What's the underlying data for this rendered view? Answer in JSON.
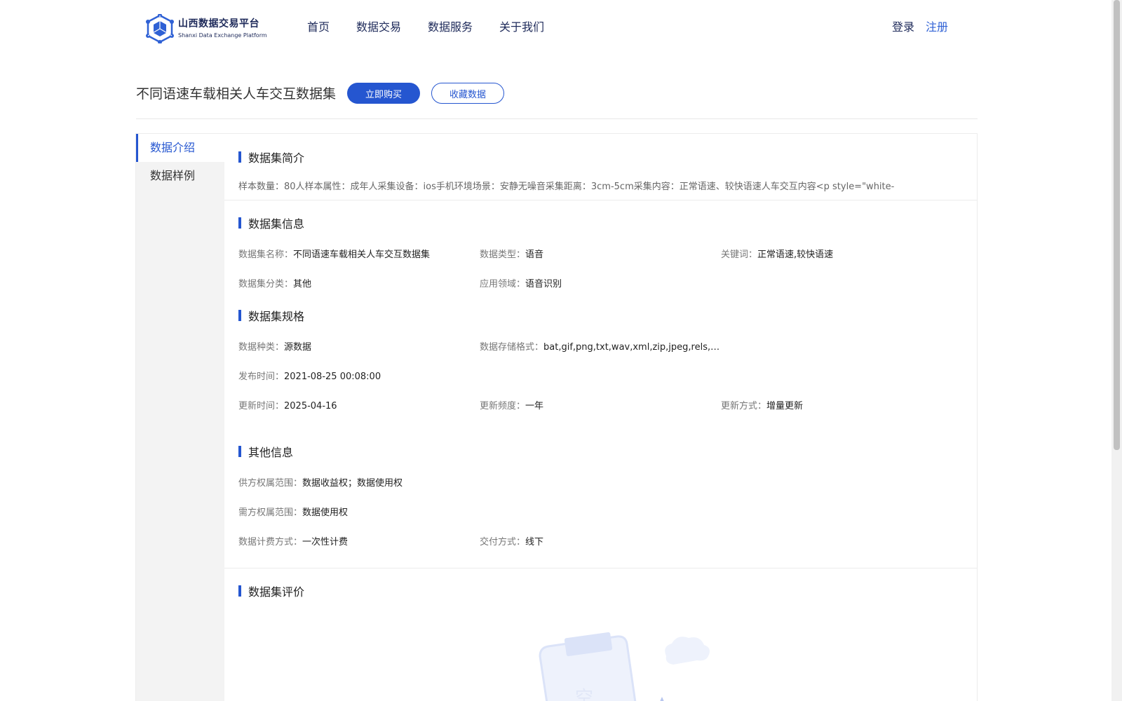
{
  "header": {
    "logo_cn": "山西数据交易平台",
    "logo_en": "Shanxi Data Exchange Platform",
    "nav": [
      "首页",
      "数据交易",
      "数据服务",
      "关于我们"
    ],
    "login": "登录",
    "register": "注册"
  },
  "dataset": {
    "title": "不同语速车载相关人车交互数据集",
    "buy_label": "立即购买",
    "fav_label": "收藏数据"
  },
  "sidebar": {
    "items": [
      "数据介绍",
      "数据样例"
    ],
    "active_index": 0
  },
  "sections": {
    "intro": {
      "heading": "数据集简介",
      "text": "样本数量：80人样本属性：成年人采集设备：ios手机环境场景：安静无噪音采集距离：3cm-5cm采集内容：正常语速、较快语速人车交互内容<p style=\"white-"
    },
    "info": {
      "heading": "数据集信息",
      "name_k": "数据集名称：",
      "name_v": "不同语速车载相关人车交互数据集",
      "type_k": "数据类型：",
      "type_v": "语音",
      "kw_k": "关键词：",
      "kw_v": "正常语速,较快语速",
      "cat_k": "数据集分类：",
      "cat_v": "其他",
      "domain_k": "应用领域：",
      "domain_v": "语音识别"
    },
    "spec": {
      "heading": "数据集规格",
      "kind_k": "数据种类：",
      "kind_v": "源数据",
      "fmt_k": "数据存储格式：",
      "fmt_v": "bat,gif,png,txt,wav,xml,zip,jpeg,rels,…",
      "pub_k": "发布时间：",
      "pub_v": "2021-08-25 00:08:00",
      "upd_k": "更新时间：",
      "upd_v": "2025-04-16",
      "freq_k": "更新频度：",
      "freq_v": "一年",
      "mode_k": "更新方式：",
      "mode_v": "增量更新"
    },
    "other": {
      "heading": "其他信息",
      "supply_k": "供方权属范围：",
      "supply_v": "数据收益权；数据使用权",
      "demand_k": "需方权属范围：",
      "demand_v": "数据使用权",
      "fee_k": "数据计费方式：",
      "fee_v": "一次性计费",
      "deliver_k": "交付方式：",
      "deliver_v": "线下"
    },
    "review": {
      "heading": "数据集评价"
    }
  },
  "colors": {
    "accent": "#2556d0",
    "nav_text": "#1e2a5a",
    "sidebar_bg": "#f3f3f3"
  }
}
